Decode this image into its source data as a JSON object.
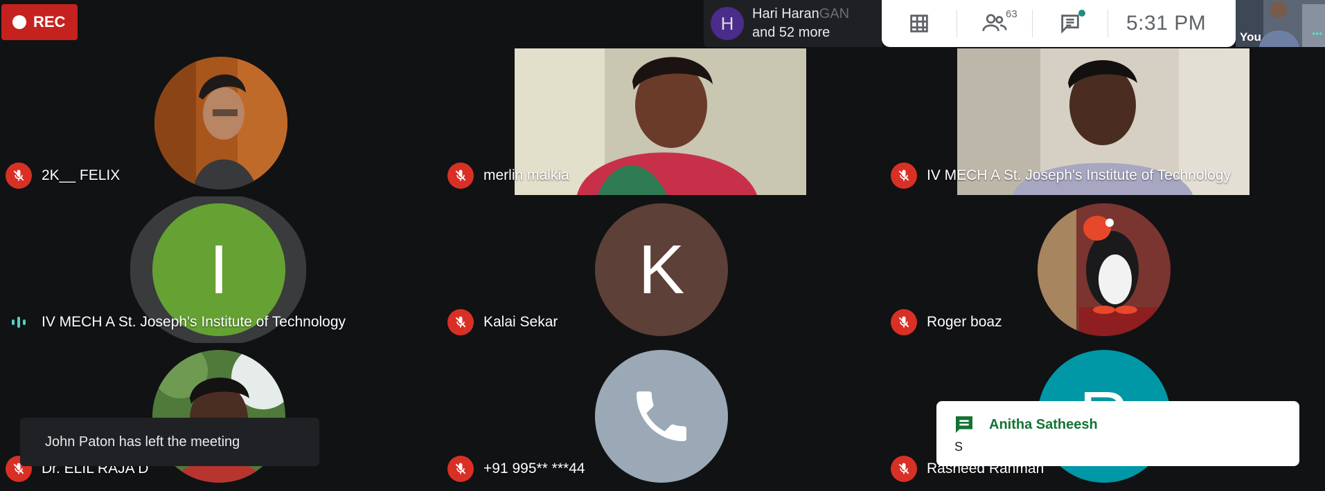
{
  "recording": {
    "label": "REC"
  },
  "presenter": {
    "initial": "H",
    "line1": "Hari Haran",
    "line1_trail": "GAN",
    "line2": "and 52 more"
  },
  "topbar": {
    "participants_count": "63",
    "time": "5:31 PM"
  },
  "self_view": {
    "label": "You"
  },
  "tiles": [
    {
      "name": "2K__ FELIX"
    },
    {
      "name": "merlin malkia"
    },
    {
      "name": "IV MECH A St. Joseph's Institute of Technology"
    },
    {
      "name": "IV MECH A St. Joseph's Institute of Technology",
      "initial": "I"
    },
    {
      "name": "Kalai Sekar",
      "initial": "K"
    },
    {
      "name": "Roger boaz"
    },
    {
      "name": "Dr. ELIL RAJA D"
    },
    {
      "name": "+91 995** ***44"
    },
    {
      "name": "Rasheed Rahman",
      "initial": "R"
    }
  ],
  "toast": {
    "text": "John Paton has left the meeting"
  },
  "chat_popup": {
    "sender": "Anitha Satheesh",
    "message": "S"
  },
  "colors": {
    "rec": "#c5221f",
    "mic_off": "#d93025",
    "green_avatar": "#65a233",
    "brown_avatar": "#5d4037",
    "teal_avatar": "#0097a7",
    "phone_avatar": "#9aa9b5",
    "chat_sender": "#137333"
  }
}
